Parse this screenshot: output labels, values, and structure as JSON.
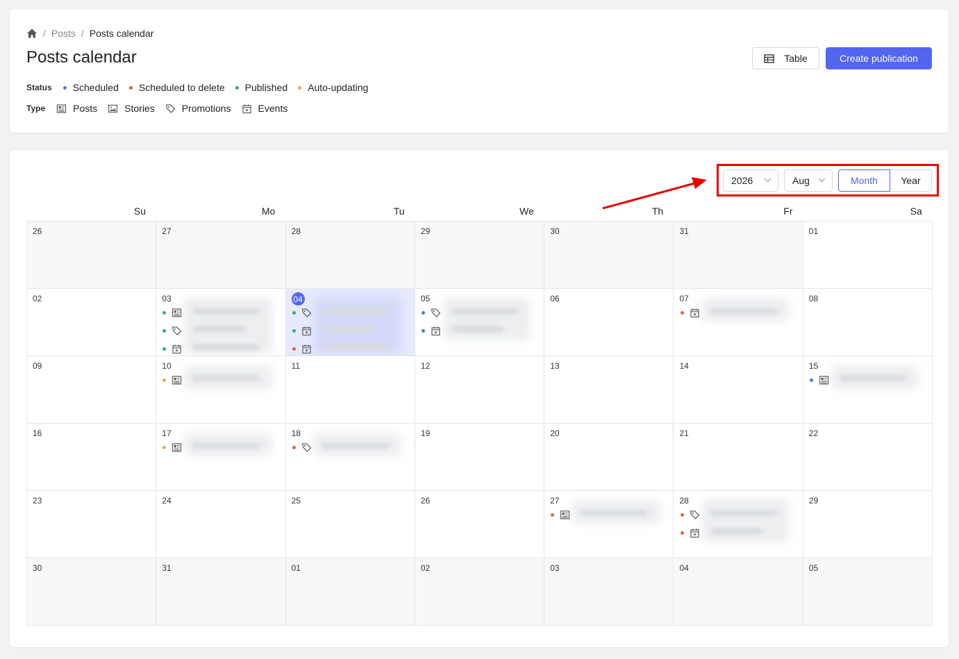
{
  "breadcrumb": {
    "parent": "Posts",
    "separator": "/",
    "current": "Posts calendar"
  },
  "page": {
    "title": "Posts calendar"
  },
  "actions": {
    "table_label": "Table",
    "create_label": "Create publication"
  },
  "legend": {
    "status_label": "Status",
    "statuses": [
      {
        "label": "Scheduled",
        "color": "#4a7cc8"
      },
      {
        "label": "Scheduled to delete",
        "color": "#e0604a"
      },
      {
        "label": "Published",
        "color": "#3aa776"
      },
      {
        "label": "Auto-updating",
        "color": "#f0a94a"
      }
    ],
    "type_label": "Type",
    "types": [
      {
        "label": "Posts",
        "icon": "post-icon"
      },
      {
        "label": "Stories",
        "icon": "image-icon"
      },
      {
        "label": "Promotions",
        "icon": "tag-icon"
      },
      {
        "label": "Events",
        "icon": "calendar-icon"
      }
    ]
  },
  "toolbar": {
    "year": "2026",
    "month": "Aug",
    "view_month": "Month",
    "view_year": "Year"
  },
  "calendar": {
    "weekdays": [
      "Su",
      "Mo",
      "Tu",
      "We",
      "Th",
      "Fr",
      "Sa"
    ],
    "weeks": [
      [
        {
          "d": "26",
          "m": true
        },
        {
          "d": "27",
          "m": true
        },
        {
          "d": "28",
          "m": true
        },
        {
          "d": "29",
          "m": true
        },
        {
          "d": "30",
          "m": true
        },
        {
          "d": "31",
          "m": true
        },
        {
          "d": "01"
        }
      ],
      [
        {
          "d": "02"
        },
        {
          "d": "03",
          "ev": [
            [
              "published",
              "post"
            ],
            [
              "published",
              "tag"
            ],
            [
              "published",
              "calendar"
            ]
          ]
        },
        {
          "d": "04",
          "today": true,
          "ev": [
            [
              "published",
              "tag"
            ],
            [
              "published",
              "calendar"
            ],
            [
              "delete",
              "calendar"
            ]
          ]
        },
        {
          "d": "05",
          "ev": [
            [
              "scheduled",
              "tag"
            ],
            [
              "scheduled",
              "calendar"
            ]
          ]
        },
        {
          "d": "06"
        },
        {
          "d": "07",
          "ev": [
            [
              "delete",
              "calendar"
            ]
          ]
        },
        {
          "d": "08"
        }
      ],
      [
        {
          "d": "09"
        },
        {
          "d": "10",
          "ev": [
            [
              "auto",
              "post"
            ]
          ]
        },
        {
          "d": "11"
        },
        {
          "d": "12"
        },
        {
          "d": "13"
        },
        {
          "d": "14"
        },
        {
          "d": "15",
          "ev": [
            [
              "scheduled",
              "post"
            ]
          ]
        }
      ],
      [
        {
          "d": "16"
        },
        {
          "d": "17",
          "ev": [
            [
              "auto",
              "post"
            ]
          ]
        },
        {
          "d": "18",
          "ev": [
            [
              "delete",
              "tag"
            ]
          ]
        },
        {
          "d": "19"
        },
        {
          "d": "20"
        },
        {
          "d": "21"
        },
        {
          "d": "22"
        }
      ],
      [
        {
          "d": "23"
        },
        {
          "d": "24"
        },
        {
          "d": "25"
        },
        {
          "d": "26"
        },
        {
          "d": "27",
          "ev": [
            [
              "delete",
              "post"
            ]
          ]
        },
        {
          "d": "28",
          "ev": [
            [
              "delete",
              "tag"
            ],
            [
              "delete",
              "calendar"
            ]
          ]
        },
        {
          "d": "29"
        }
      ],
      [
        {
          "d": "30",
          "m": true
        },
        {
          "d": "31",
          "m": true
        },
        {
          "d": "01",
          "m": true
        },
        {
          "d": "02",
          "m": true
        },
        {
          "d": "03",
          "m": true
        },
        {
          "d": "04",
          "m": true
        },
        {
          "d": "05",
          "m": true
        }
      ]
    ]
  },
  "colors": {
    "accent": "#5365f3",
    "highlight": "#e80000",
    "scheduled": "#4a7cc8",
    "delete": "#e0604a",
    "published": "#3aa776",
    "auto": "#f0a94a"
  }
}
